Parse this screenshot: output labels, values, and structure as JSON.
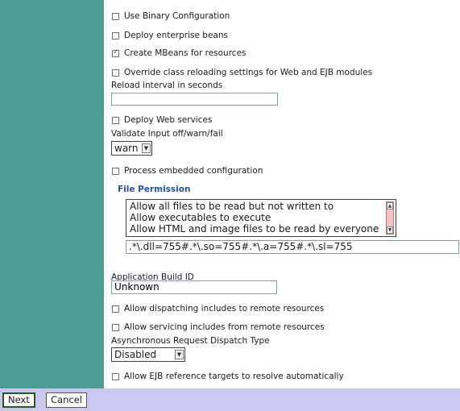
{
  "options": {
    "use_binary": {
      "label": "Use Binary Configuration",
      "checked": false
    },
    "deploy_ejb": {
      "label": "Deploy enterprise beans",
      "checked": false
    },
    "create_mbeans": {
      "label": "Create MBeans for resources",
      "checked": true
    },
    "override_reload": {
      "label": "Override class reloading settings for Web and EJB modules",
      "checked": false
    },
    "reload_interval_label": "Reload interval in seconds",
    "reload_interval_value": "",
    "deploy_ws": {
      "label": "Deploy Web services",
      "checked": false
    },
    "validate_label": "Validate Input off/warn/fail",
    "validate_value": "warn",
    "process_embedded": {
      "label": "Process embedded configuration",
      "checked": false
    }
  },
  "file_permission": {
    "title": "File Permission",
    "items": [
      "Allow all files to be read but not written to",
      "Allow executables to execute",
      "Allow HTML and image files to be read by everyone"
    ],
    "value": ".*\\.dll=755#.*\\.so=755#.*\\.a=755#.*\\.sl=755"
  },
  "build": {
    "label": "Application Build ID",
    "value": "Unknown"
  },
  "dispatch": {
    "allow_dispatching": {
      "label": "Allow dispatching includes to remote resources",
      "checked": false
    },
    "allow_servicing": {
      "label": "Allow servicing includes from remote resources",
      "checked": false
    },
    "async_label": "Asynchronous Request Dispatch Type",
    "async_value": "Disabled",
    "allow_ejb_ref": {
      "label": "Allow EJB reference targets to resolve automatically",
      "checked": false
    }
  },
  "footer": {
    "next_label": "Next",
    "cancel_label": "Cancel"
  },
  "colors": {
    "sidebar": "#4b9c92",
    "footer": "#c9c7f0",
    "section_title": "#2a4fa3"
  }
}
